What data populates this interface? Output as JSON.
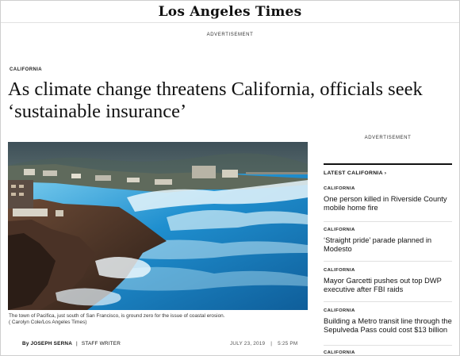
{
  "masthead": {
    "logo_text": "Los Angeles Times"
  },
  "ads": {
    "top_label": "ADVERTISEMENT",
    "side_label": "ADVERTISEMENT"
  },
  "article": {
    "section": "CALIFORNIA",
    "headline": "As climate change threatens California, officials seek ‘sustainable insurance’",
    "caption_line1": "The town of Pacifica, just south of San Francisco, is ground zero for the issue of coastal erosion.",
    "caption_line2": "( Carolyn Cole/Los Angeles Times)",
    "byline_author": "By JOSEPH SERNA",
    "byline_separator": "|",
    "byline_role": "STAFF WRITER",
    "date": "JULY 23, 2019",
    "time": "5:25 PM"
  },
  "sidebar": {
    "heading": "LATEST CALIFORNIA",
    "heading_icon": "chevron-right-icon",
    "items": [
      {
        "category": "CALIFORNIA",
        "title": "One person killed in Riverside County mobile home fire"
      },
      {
        "category": "CALIFORNIA",
        "title": "‘Straight pride’ parade planned in Modesto"
      },
      {
        "category": "CALIFORNIA",
        "title": "Mayor Garcetti pushes out top DWP executive after FBI raids"
      },
      {
        "category": "CALIFORNIA",
        "title": "Building a Metro transit line through the Sepulveda Pass could cost $13 billion"
      },
      {
        "category": "CALIFORNIA",
        "title": ""
      }
    ]
  },
  "colors": {
    "text": "#111111",
    "divider": "#e0e0e0",
    "ocean": "#2a8fc8"
  }
}
